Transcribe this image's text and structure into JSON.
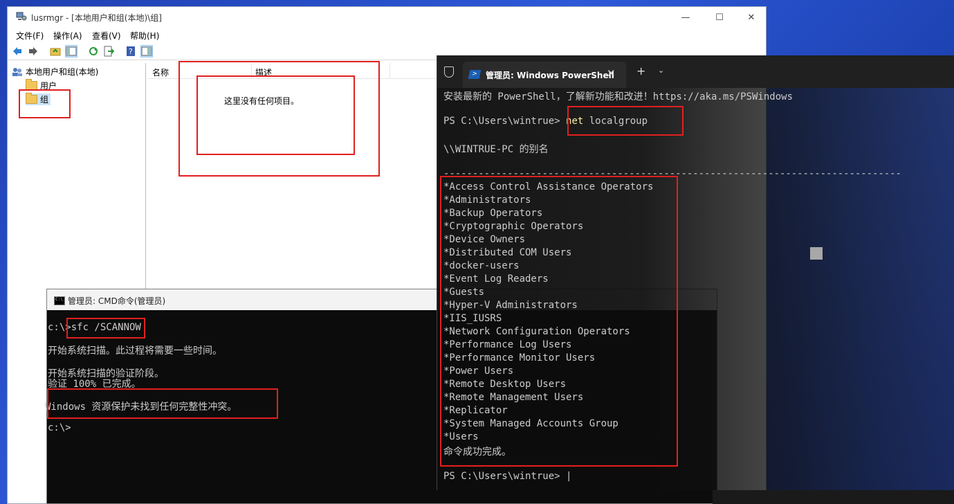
{
  "lusrmgr": {
    "title": "lusrmgr - [本地用户和组(本地)\\组]",
    "menu": [
      "文件(F)",
      "操作(A)",
      "查看(V)",
      "帮助(H)"
    ],
    "tree_root": "本地用户和组(本地)",
    "tree_items": [
      "用户",
      "组"
    ],
    "columns": [
      "名称",
      "描述"
    ],
    "empty_text": "这里没有任何项目。",
    "buttons": {
      "minimize": "—",
      "maximize": "☐",
      "close": "✕"
    }
  },
  "cmd": {
    "title": "管理员: CMD命令(管理员)",
    "prompt1": "c:\\>",
    "command": "sfc /SCANNOW",
    "line1": "开始系统扫描。此过程将需要一些时间。",
    "line2": "开始系统扫描的验证阶段。",
    "line3": "验证 100% 已完成。",
    "line4": "Windows 资源保护未找到任何完整性冲突。",
    "prompt2": "c:\\>"
  },
  "powershell": {
    "tab_title": "管理员: Windows PowerShell",
    "tab_close": "✕",
    "new_tab": "+",
    "dropdown": "⌄",
    "banner": "安装最新的 PowerShell，了解新功能和改进！https://aka.ms/PSWindows",
    "prompt": "PS C:\\Users\\wintrue>",
    "cmd_word": "net",
    "cmd_arg": "localgroup",
    "alias_header": "\\\\WINTRUE-PC 的别名",
    "separator": "-------------------------------------------------------------------------------",
    "groups": [
      "*Access Control Assistance Operators",
      "*Administrators",
      "*Backup Operators",
      "*Cryptographic Operators",
      "*Device Owners",
      "*Distributed COM Users",
      "*docker-users",
      "*Event Log Readers",
      "*Guests",
      "*Hyper-V Administrators",
      "*IIS_IUSRS",
      "*Network Configuration Operators",
      "*Performance Log Users",
      "*Performance Monitor Users",
      "*Power Users",
      "*Remote Desktop Users",
      "*Remote Management Users",
      "*Replicator",
      "*System Managed Accounts Group",
      "*Users"
    ],
    "success": "命令成功完成。",
    "final_prompt": "PS C:\\Users\\wintrue>",
    "cursor": "|"
  },
  "colors": {
    "annotation": "#e02020",
    "ps_command": "#f9f1a5",
    "terminal_text": "#cccccc"
  }
}
